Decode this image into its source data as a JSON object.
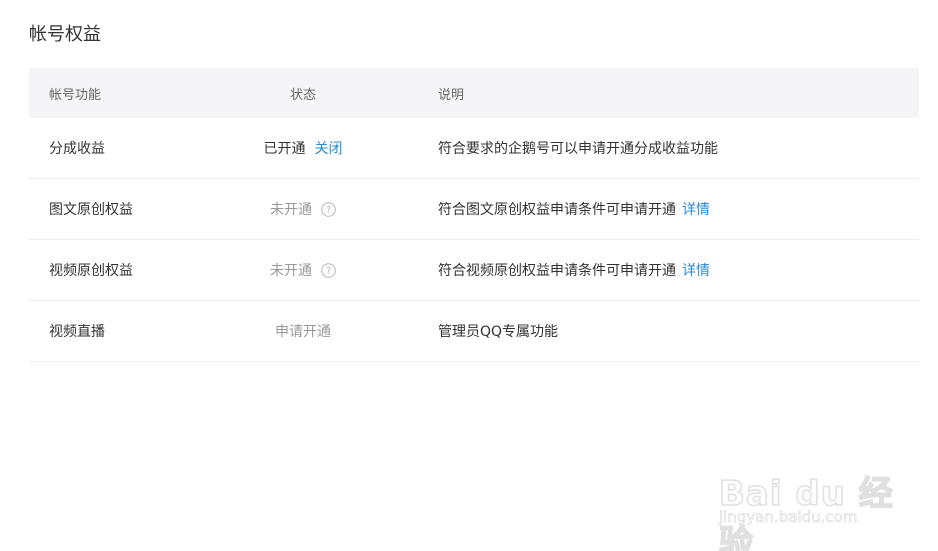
{
  "page": {
    "title": "帐号权益"
  },
  "table": {
    "headers": {
      "function": "帐号功能",
      "status": "状态",
      "description": "说明"
    },
    "rows": [
      {
        "function": "分成收益",
        "status": "已开通",
        "status_action": "关闭",
        "description": "符合要求的企鹅号可以申请开通分成收益功能",
        "desc_link": ""
      },
      {
        "function": "图文原创权益",
        "status": "未开通",
        "status_icon": "question-circle-icon",
        "description": "符合图文原创权益申请条件可申请开通",
        "desc_link": "详情"
      },
      {
        "function": "视频原创权益",
        "status": "未开通",
        "status_icon": "question-circle-icon",
        "description": "符合视频原创权益申请条件可申请开通",
        "desc_link": "详情"
      },
      {
        "function": "视频直播",
        "status": "申请开通",
        "description": "管理员QQ专属功能",
        "desc_link": ""
      }
    ]
  },
  "watermark": {
    "brand": "Bai du 经验",
    "url": "jingyan.baidu.com"
  },
  "colors": {
    "link": "#2a8ad5",
    "header_bg": "#f5f5f7",
    "muted": "#999999",
    "divider": "#eeeeee"
  }
}
